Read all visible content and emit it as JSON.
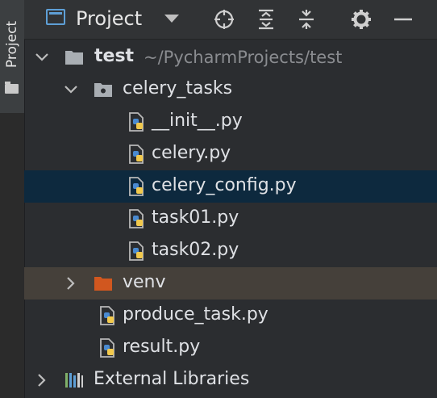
{
  "sidebar": {
    "project_tab_label": "Project"
  },
  "header": {
    "title": "Project"
  },
  "tree": {
    "root": {
      "name": "test",
      "path": "~/PycharmProjects/test"
    },
    "package": {
      "name": "celery_tasks"
    },
    "files": [
      {
        "name": "__init__.py"
      },
      {
        "name": "celery.py"
      },
      {
        "name": "celery_config.py"
      },
      {
        "name": "task01.py"
      },
      {
        "name": "task02.py"
      }
    ],
    "venv": {
      "name": "venv"
    },
    "root_files": [
      {
        "name": "produce_task.py"
      },
      {
        "name": "result.py"
      }
    ],
    "external": {
      "name": "External Libraries"
    }
  },
  "colors": {
    "selected_row": "#0d293e",
    "venv_row": "#45403a",
    "accent_blue": "#5e9fd6",
    "venv_folder": "#d1571f"
  }
}
